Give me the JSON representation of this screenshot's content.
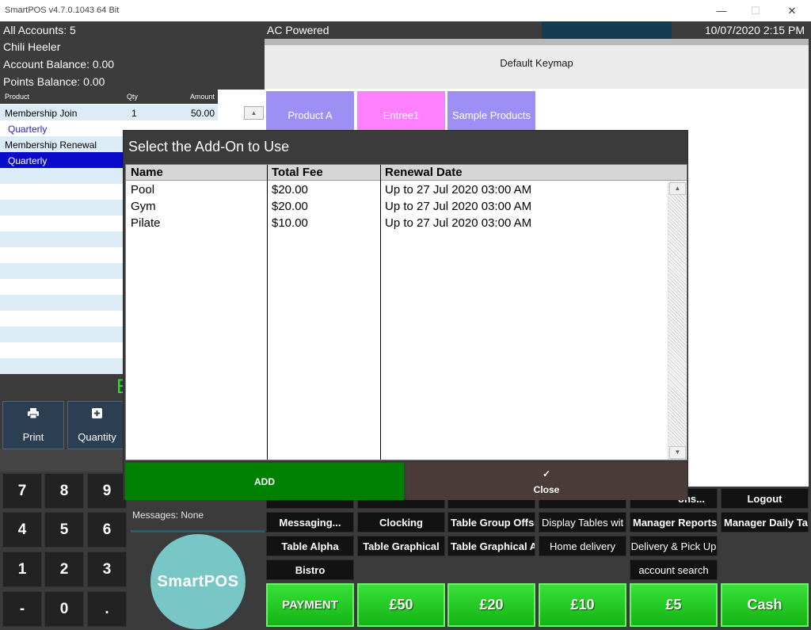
{
  "window": {
    "title": "SmartPOS v4.7.0.1043 64 Bit",
    "minimize_icon": "—",
    "maximize_icon": "☐",
    "close_icon": "✕"
  },
  "status_bar": {
    "accounts": "All Accounts: 5",
    "power": "AC Powered",
    "datetime": "10/07/2020 2:15 PM"
  },
  "customer": {
    "name": "Chili Heeler",
    "account_balance": "Account Balance: 0.00",
    "points_balance": "Points Balance: 0.00"
  },
  "order": {
    "columns": {
      "product": "Product",
      "qty": "Qty",
      "amount": "Amount"
    },
    "lines": [
      {
        "product": "Membership Join",
        "qty": "1",
        "amount": "50.00"
      },
      {
        "product": "Quarterly"
      },
      {
        "product": "Membership Renewal"
      },
      {
        "product": "Quarterly",
        "selected": true
      }
    ],
    "scroll_up_icon": "▲",
    "total_fragment": "E"
  },
  "keymap": {
    "name": "Default Keymap",
    "products": [
      {
        "label": "Product A",
        "color": "#9d8ff4"
      },
      {
        "label": "Entree1",
        "color": "#ff80ff"
      },
      {
        "label": "Sample Products",
        "color": "#9d8ff4"
      }
    ]
  },
  "actions": {
    "print": {
      "label": "Print",
      "icon": "printer-icon"
    },
    "quantity": {
      "label": "Quantity",
      "icon": "plus-square-icon"
    }
  },
  "numpad": [
    "7",
    "8",
    "9",
    "4",
    "5",
    "6",
    "1",
    "2",
    "3",
    "-",
    "0",
    "."
  ],
  "messages": "Messages: None",
  "logo": "SmartPOS",
  "function_buttons": {
    "row1": [
      "",
      "",
      "",
      "",
      "ons...",
      "Logout"
    ],
    "row2": [
      "Messaging...",
      "Clocking",
      "Table Group Offse",
      "Display Tables wit",
      "Manager Reports",
      "Manager Daily Tas"
    ],
    "row3": [
      "Table Alpha",
      "Table Graphical",
      "Table Graphical A",
      "Home delivery",
      "Delivery & Pick Up"
    ],
    "row4": [
      "Bistro",
      "account search"
    ]
  },
  "payment_buttons": [
    "PAYMENT",
    "£50",
    "£20",
    "£10",
    "£5",
    "Cash"
  ],
  "addon_dialog": {
    "title": "Select the Add-On to Use",
    "columns": [
      "Name",
      "Total Fee",
      "Renewal Date"
    ],
    "rows": [
      {
        "name": "Pool",
        "fee": "$20.00",
        "renewal": "Up to 27 Jul 2020 03:00 AM"
      },
      {
        "name": "Gym",
        "fee": "$20.00",
        "renewal": "Up to 27 Jul 2020 03:00 AM"
      },
      {
        "name": "Pilate",
        "fee": "$10.00",
        "renewal": "Up to 27 Jul 2020 03:00 AM"
      }
    ],
    "scroll_up_icon": "▲",
    "scroll_down_icon": "▼",
    "add_label": "ADD",
    "close_label": "Close",
    "close_icon": "✓"
  },
  "colors": {
    "selected_row": "#0a0ac8",
    "stripe": "#dcecf7",
    "add_button": "#008000",
    "close_button": "#4b3b39",
    "payment_green": "#1ec81e",
    "logo": "#79c6c6",
    "dark_panel": "#3b3b3b"
  }
}
